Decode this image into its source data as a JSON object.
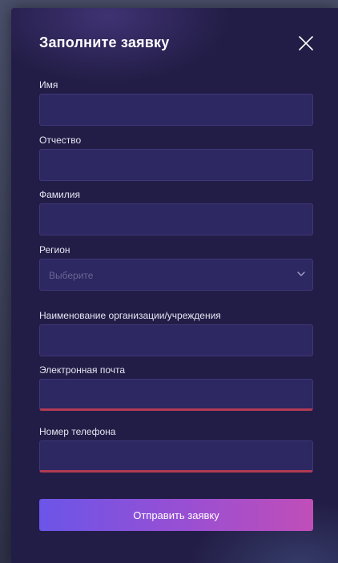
{
  "modal": {
    "title": "Заполните заявку"
  },
  "form": {
    "first_name_label": "Имя",
    "patronymic_label": "Отчество",
    "last_name_label": "Фамилия",
    "region_label": "Регион",
    "region_placeholder": "Выберите",
    "organization_label": "Наименование организации/учреждения",
    "email_label": "Электронная почта",
    "phone_label": "Номер телефона",
    "submit_label": "Отправить заявку"
  },
  "colors": {
    "background": "#221d46",
    "field": "#2d2861",
    "error_underline": "#b23a55",
    "button_start": "#6b55e8",
    "button_end": "#c14eb8"
  },
  "icons": {
    "close": "close-icon",
    "chevron": "chevron-down-icon"
  }
}
